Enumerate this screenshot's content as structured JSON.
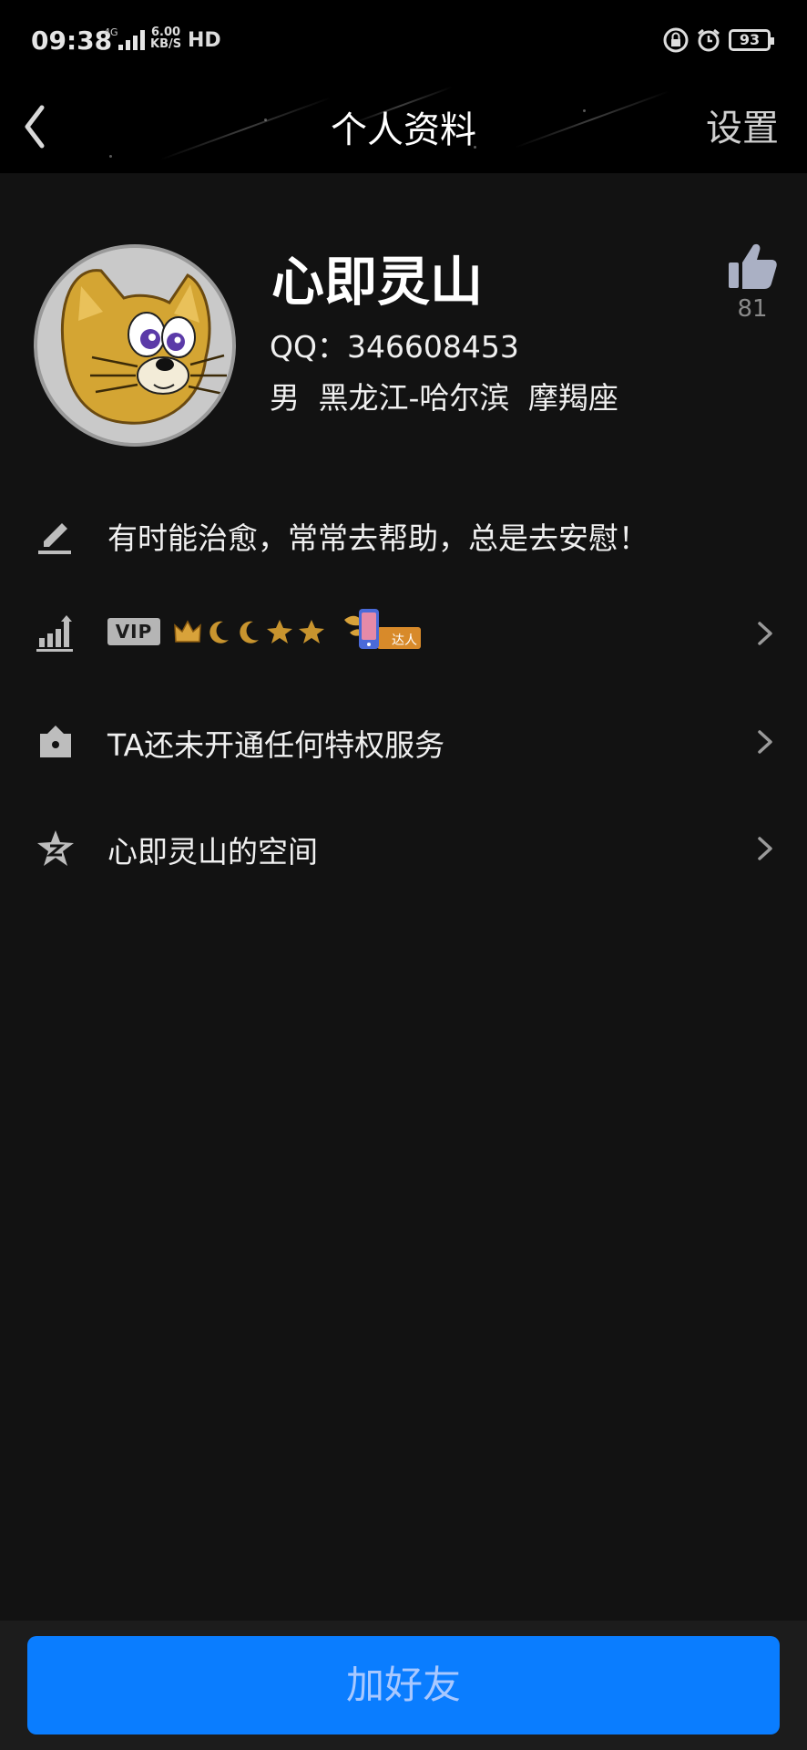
{
  "status_bar": {
    "time": "09:38",
    "network": "4G",
    "speed_value": "6.00",
    "speed_unit": "KB/S",
    "hd": "HD",
    "battery": "93"
  },
  "nav": {
    "title": "个人资料",
    "settings": "设置"
  },
  "profile": {
    "nickname": "心即灵山",
    "qq": "QQ：346608453",
    "info": "男 黑龙江-哈尔滨 摩羯座",
    "likes": "81"
  },
  "rows": {
    "signature": "有时能治愈，常常去帮助，总是去安慰！",
    "vip_label": "VIP",
    "daren_label": "达人",
    "privilege": "TA还未开通任何特权服务",
    "space": "心即灵山的空间"
  },
  "actions": {
    "add_friend": "加好友"
  },
  "colors": {
    "background": "#121212",
    "header": "#000000",
    "accent": "#0a7dff"
  }
}
